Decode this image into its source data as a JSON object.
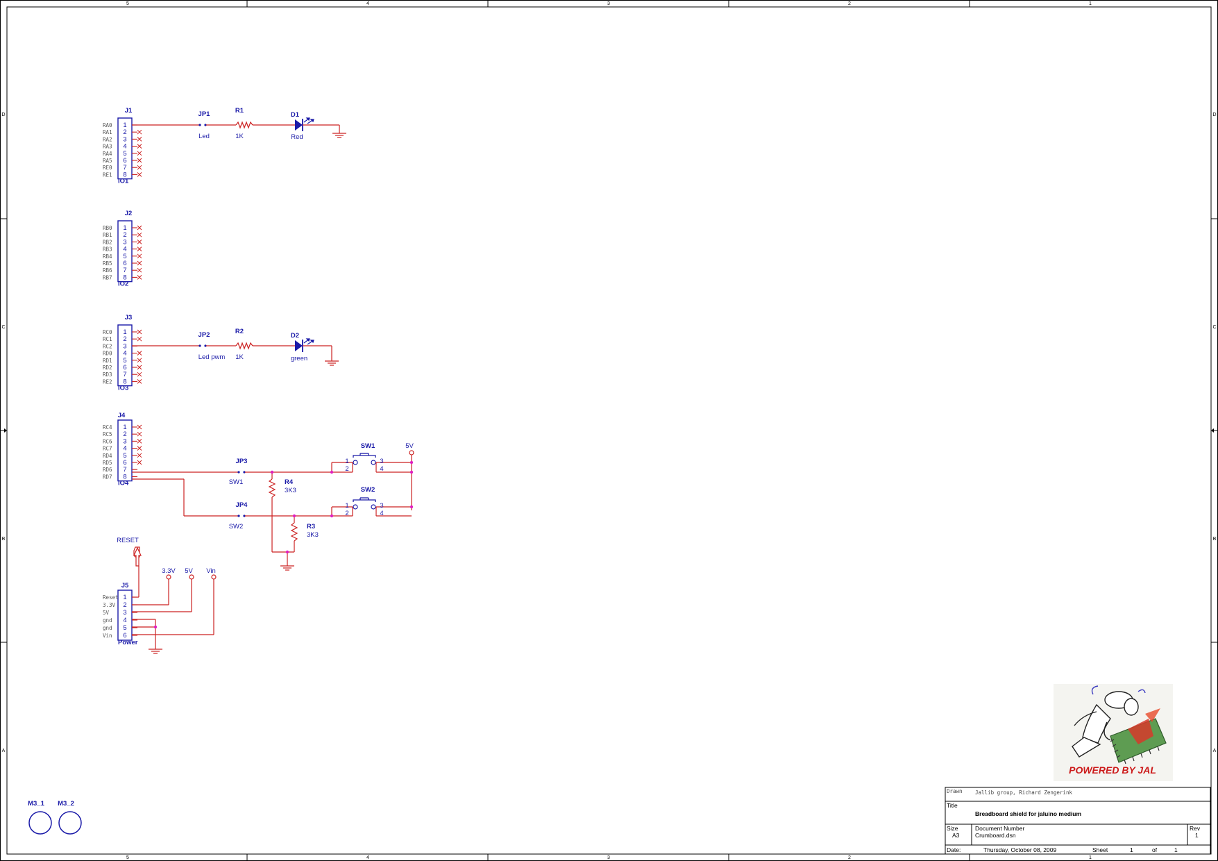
{
  "frame": {
    "col_labels": [
      "5",
      "4",
      "3",
      "2",
      "1"
    ],
    "row_labels": [
      "D",
      "C",
      "B",
      "A"
    ]
  },
  "connectors": [
    {
      "ref": "J1",
      "name": "IO1",
      "pins": [
        "1",
        "2",
        "3",
        "4",
        "5",
        "6",
        "7",
        "8"
      ],
      "signals": [
        "RA0",
        "RA1",
        "RA2",
        "RA3",
        "RA4",
        "RA5",
        "RE0",
        "RE1"
      ]
    },
    {
      "ref": "J2",
      "name": "IO2",
      "pins": [
        "1",
        "2",
        "3",
        "4",
        "5",
        "6",
        "7",
        "8"
      ],
      "signals": [
        "RB0",
        "RB1",
        "RB2",
        "RB3",
        "RB4",
        "RB5",
        "RB6",
        "RB7"
      ]
    },
    {
      "ref": "J3",
      "name": "IO3",
      "pins": [
        "1",
        "2",
        "3",
        "4",
        "5",
        "6",
        "7",
        "8"
      ],
      "signals": [
        "RC0",
        "RC1",
        "RC2",
        "RD0",
        "RD1",
        "RD2",
        "RD3",
        "RE2"
      ]
    },
    {
      "ref": "J4",
      "name": "IO4",
      "pins": [
        "1",
        "2",
        "3",
        "4",
        "5",
        "6",
        "7",
        "8"
      ],
      "signals": [
        "RC4",
        "RC5",
        "RC6",
        "RC7",
        "RD4",
        "RD5",
        "RD6",
        "RD7"
      ]
    },
    {
      "ref": "J5",
      "name": "Power",
      "pins": [
        "1",
        "2",
        "3",
        "4",
        "5",
        "6"
      ],
      "signals": [
        "Reset",
        "3.3V",
        "5V",
        "gnd",
        "gnd",
        "Vin"
      ]
    }
  ],
  "parts": {
    "jp1": {
      "ref": "JP1",
      "value": "Led"
    },
    "r1": {
      "ref": "R1",
      "value": "1K"
    },
    "d1": {
      "ref": "D1",
      "value": "Red"
    },
    "jp2": {
      "ref": "JP2",
      "value": "Led pwm"
    },
    "r2": {
      "ref": "R2",
      "value": "1K"
    },
    "d2": {
      "ref": "D2",
      "value": "green"
    },
    "jp3": {
      "ref": "JP3",
      "value": "SW1"
    },
    "jp4": {
      "ref": "JP4",
      "value": "SW2"
    },
    "r4": {
      "ref": "R4",
      "value": "3K3"
    },
    "r3": {
      "ref": "R3",
      "value": "3K3"
    },
    "sw1": {
      "ref": "SW1",
      "pins": [
        "1",
        "2",
        "3",
        "4"
      ]
    },
    "sw2": {
      "ref": "SW2",
      "pins": [
        "1",
        "2",
        "3",
        "4"
      ]
    },
    "m3_1": {
      "ref": "M3_1"
    },
    "m3_2": {
      "ref": "M3_2"
    }
  },
  "nets": {
    "vcc_5v": "5V",
    "reset": "RESET",
    "v33": "3.3V",
    "v5": "5V",
    "vin": "Vin"
  },
  "title_block": {
    "drawn_label": "Drawn",
    "drawn_value": "Jallib group, Richard Zengerink",
    "title_label": "Title",
    "title_value": "Breadboard shield for jaluino medium",
    "size_label": "Size",
    "size_value": "A3",
    "docnum_label": "Document Number",
    "docnum_value": "Crumboard.dsn",
    "rev_label": "Rev",
    "rev_value": "1",
    "date_label": "Date:",
    "date_value": "Thursday, October 08, 2009",
    "sheet_label": "Sheet",
    "sheet_value": "1",
    "of_label": "of",
    "of_value": "1"
  },
  "logo": {
    "text": "POWERED BY JAL"
  },
  "colors": {
    "component": "#1a1aa8",
    "wire": "#cc2222",
    "junction": "#e020c0"
  }
}
